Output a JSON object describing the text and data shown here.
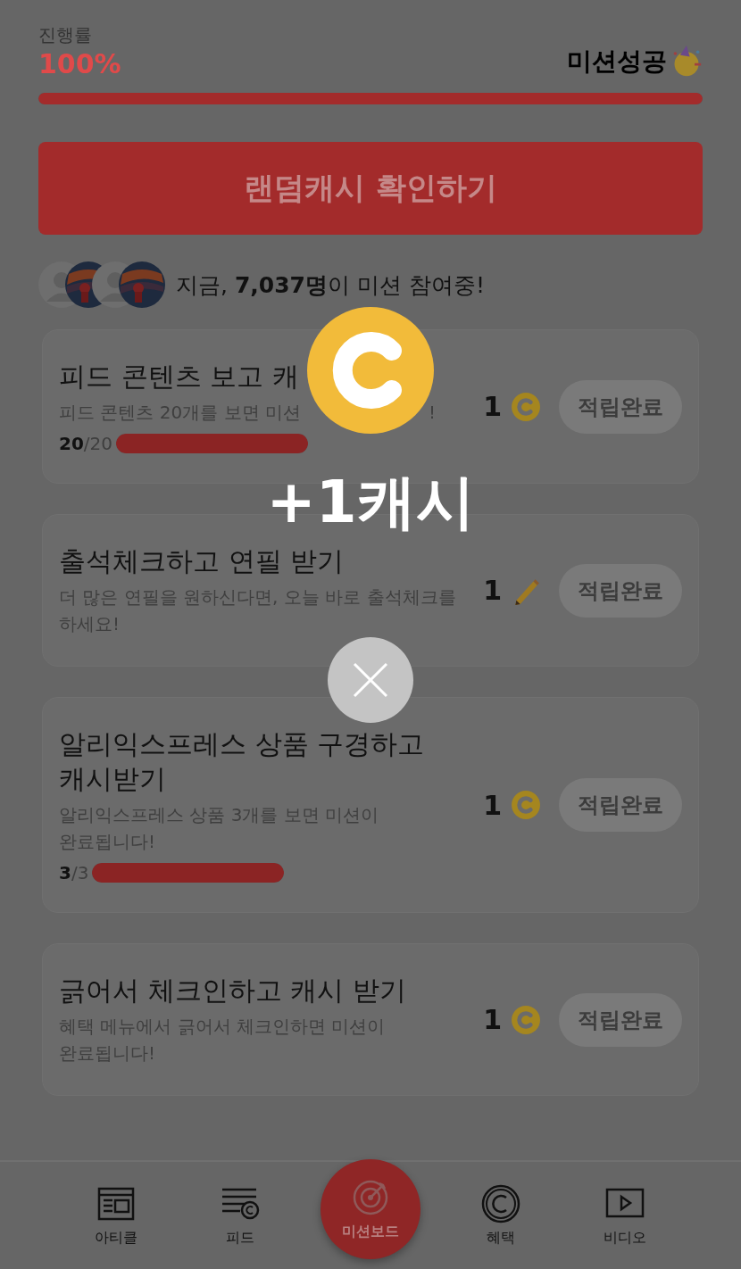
{
  "progress": {
    "label": "진행률",
    "value": "100%",
    "level": 1,
    "status": "미션성공"
  },
  "random_cash_button": "랜덤캐시 확인하기",
  "participants": {
    "avatars": [
      {
        "kind": "default"
      },
      {
        "kind": "picture"
      },
      {
        "kind": "default"
      },
      {
        "kind": "picture"
      }
    ],
    "text": "지금, **7,037명**이 미션 참여중!"
  },
  "missions": [
    {
      "title": "피드 콘텐츠 보고 캐",
      "description": "피드 콘텐츠 20개를 보면 미션",
      "description_tail": "!",
      "progress": {
        "done": "20",
        "total": "/20",
        "level": 1
      },
      "reward": "1",
      "kind": "cash",
      "button": "적립완료"
    },
    {
      "title": "출석체크하고 연필 받기",
      "description": "더 많은 연필을 원하신다면, 오늘 바로 출석체크를 하세요!",
      "reward": "1",
      "kind": "pencil",
      "button": "적립완료"
    },
    {
      "title": "알리익스프레스 상품 구경하고 캐시받기",
      "description": "알리익스프레스 상품 3개를 보면 미션이 완료됩니다!",
      "progress": {
        "done": "3",
        "total": "/3",
        "level": 1
      },
      "reward": "1",
      "kind": "cash",
      "button": "적립완료"
    },
    {
      "title": "긁어서 체크인하고 캐시 받기",
      "description": "혜택 메뉴에서 긁어서 체크인하면 미션이 완료됩니다!",
      "reward": "1",
      "kind": "cash",
      "button": "적립완료"
    }
  ],
  "reward_popup": {
    "amount": "+1캐시"
  },
  "nav": [
    {
      "label": "아티클",
      "kind": "article",
      "selected": false
    },
    {
      "label": "피드",
      "kind": "feed",
      "selected": false
    },
    {
      "label": "미션보드",
      "kind": "target",
      "selected": true
    },
    {
      "label": "혜택",
      "kind": "benefit",
      "selected": false
    },
    {
      "label": "비디오",
      "kind": "video",
      "selected": false
    }
  ]
}
